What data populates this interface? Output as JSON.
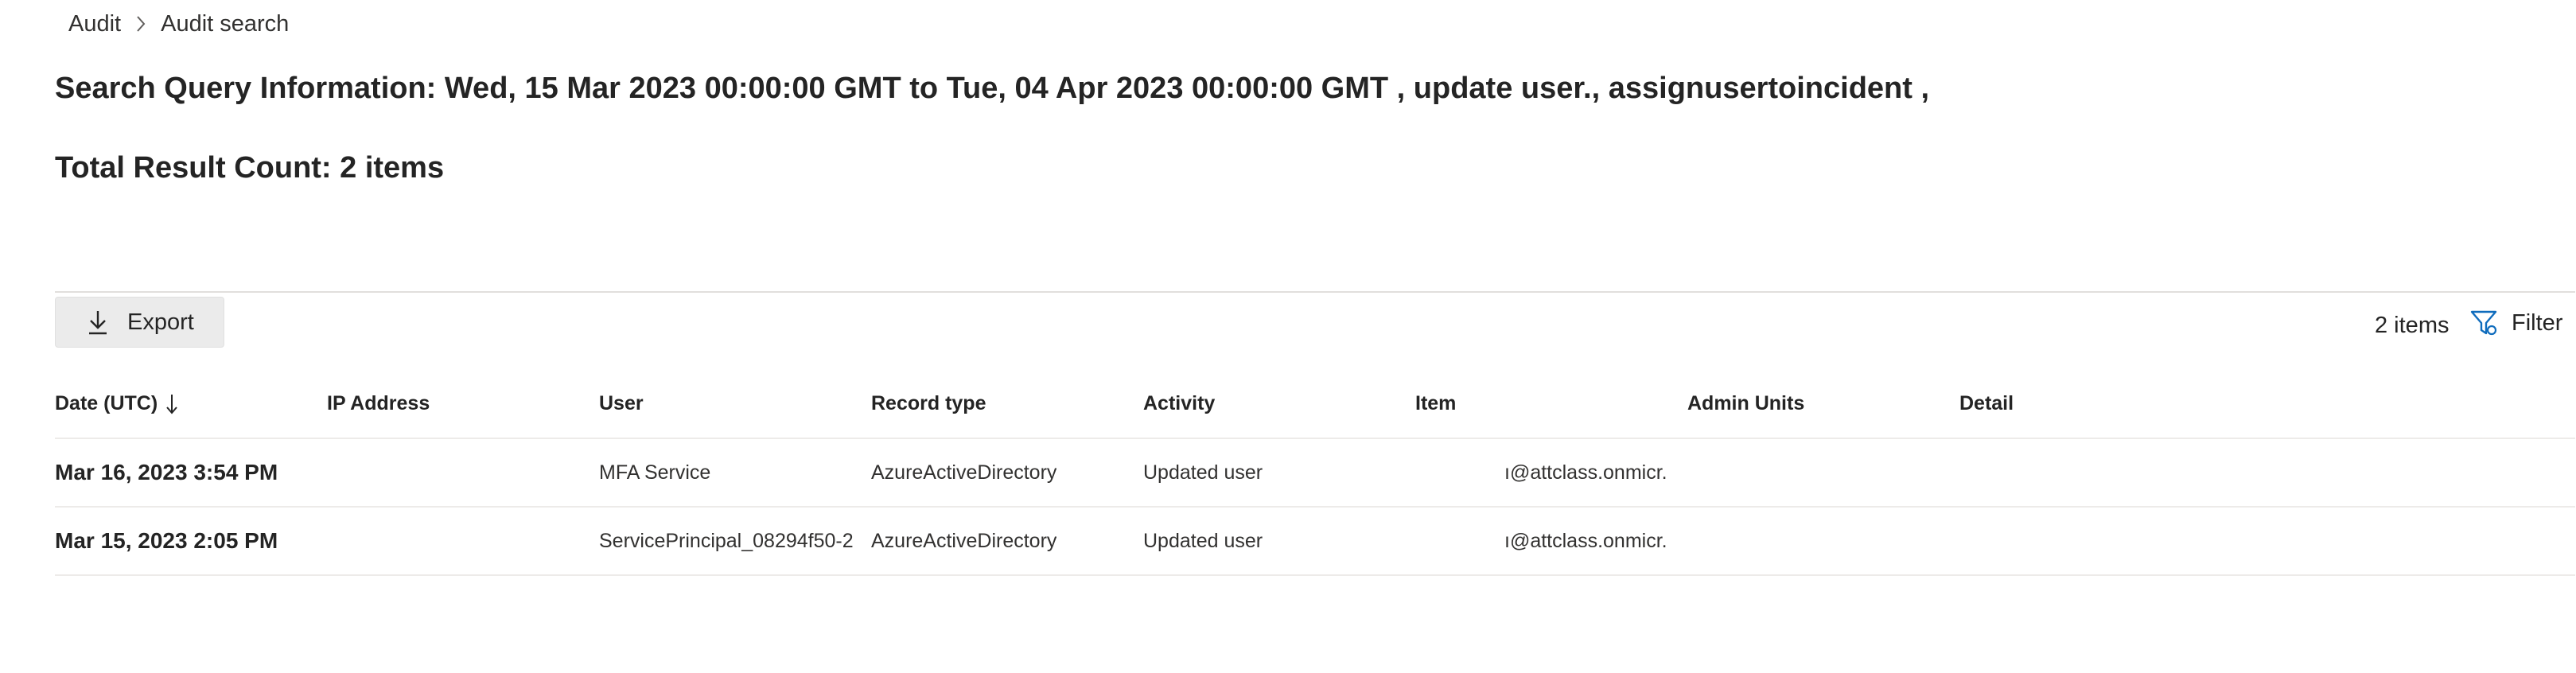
{
  "breadcrumb": {
    "items": [
      "Audit",
      "Audit search"
    ]
  },
  "search": {
    "query_info": "Search Query Information: Wed, 15 Mar 2023 00:00:00 GMT to Tue, 04 Apr 2023 00:00:00 GMT , update user., assignusertoincident ,",
    "total_count": "Total Result Count: 2 items"
  },
  "toolbar": {
    "export_label": "Export",
    "export_icon": "download-icon",
    "items_count": "2 items",
    "filter_label": "Filter",
    "filter_icon": "filter-icon"
  },
  "table": {
    "columns": [
      "Date (UTC)",
      "IP Address",
      "User",
      "Record type",
      "Activity",
      "Item",
      "Admin Units",
      "Detail"
    ],
    "sort_icon": "arrow-down-icon",
    "rows": [
      {
        "date": "Mar 16, 2023 3:54 PM",
        "ip": "",
        "user": "MFA Service",
        "record_type": "AzureActiveDirectory",
        "activity": "Updated user",
        "item": "ı@attclass.onmicr...",
        "admin_units": "",
        "detail": ""
      },
      {
        "date": "Mar 15, 2023 2:05 PM",
        "ip": "",
        "user": "ServicePrincipal_08294f50-2...",
        "record_type": "AzureActiveDirectory",
        "activity": "Updated user",
        "item": "ı@attclass.onmicr...",
        "admin_units": "",
        "detail": ""
      }
    ]
  },
  "colors": {
    "accent": "#0f6cbd",
    "text": "#242424",
    "button_bg": "#ebebeb",
    "divider": "#edebe9"
  }
}
